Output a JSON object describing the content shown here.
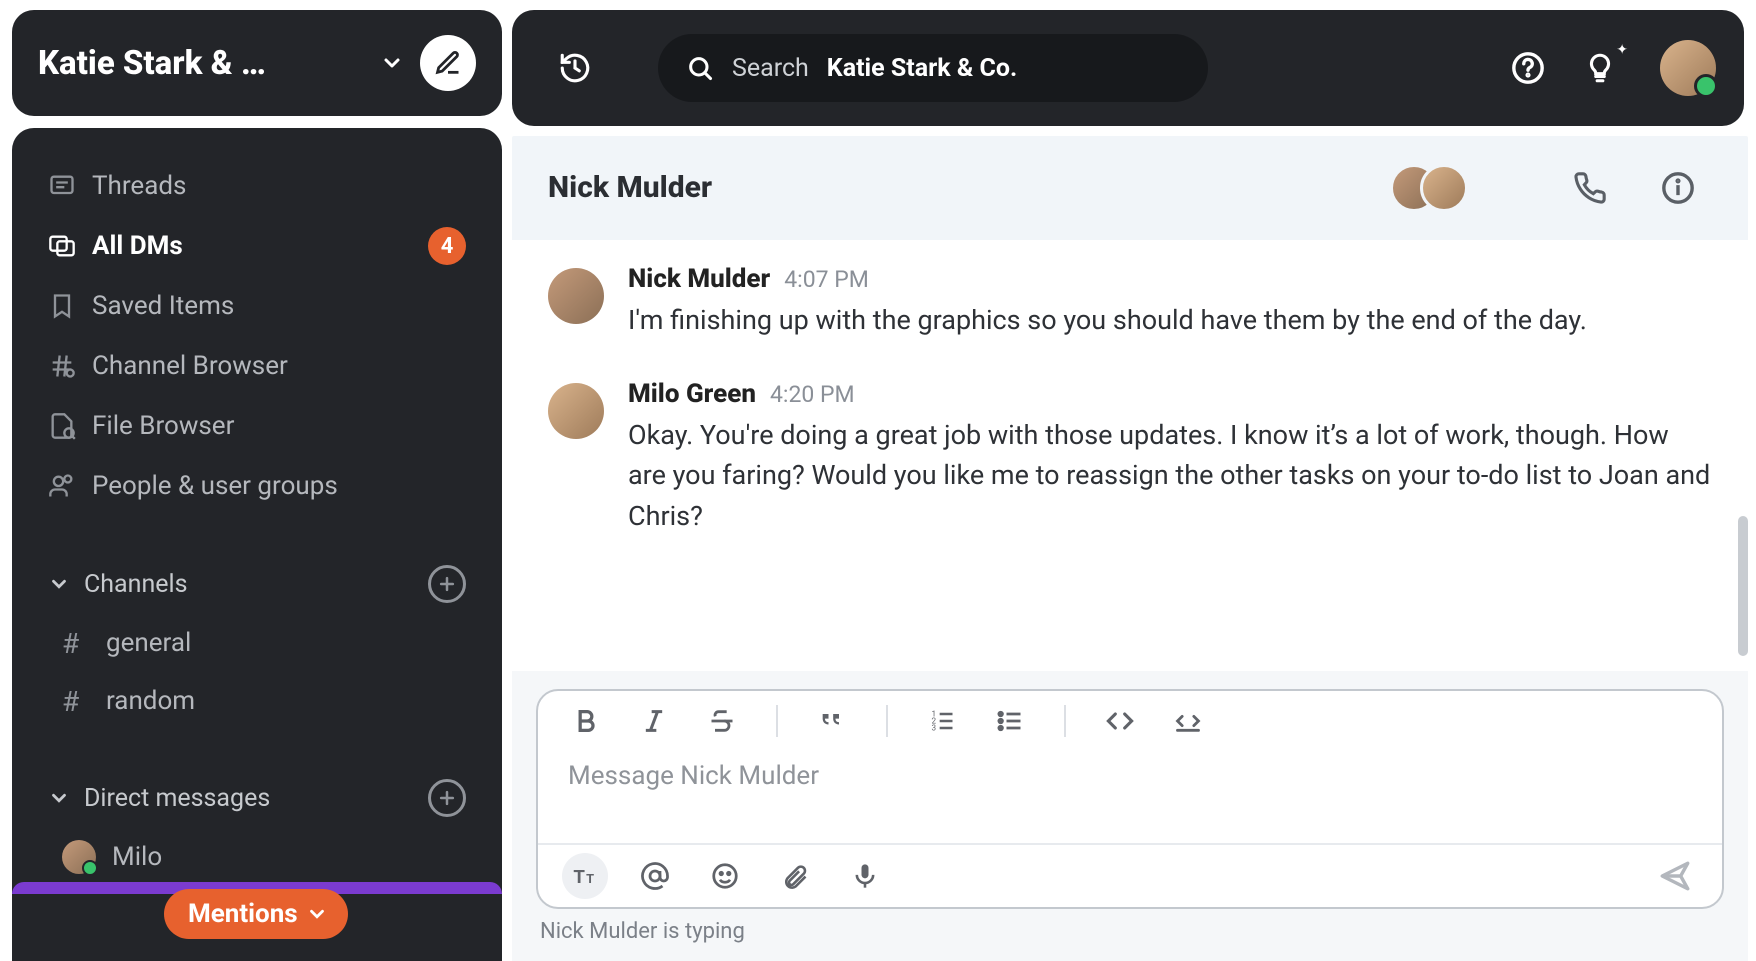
{
  "workspace": {
    "name": "Katie Stark & …"
  },
  "search": {
    "label": "Search",
    "scope": "Katie Stark & Co."
  },
  "sidebar": {
    "threads": "Threads",
    "all_dms": "All DMs",
    "all_dms_badge": "4",
    "saved_items": "Saved Items",
    "channel_browser": "Channel Browser",
    "file_browser": "File Browser",
    "people_groups": "People & user groups",
    "channels_title": "Channels",
    "channels": [
      {
        "name": "general"
      },
      {
        "name": "random"
      }
    ],
    "dms_title": "Direct messages",
    "dms": [
      {
        "name": "Milo"
      }
    ],
    "mentions_label": "Mentions"
  },
  "conversation": {
    "title": "Nick Mulder",
    "messages": [
      {
        "author": "Nick Mulder",
        "time": "4:07 PM",
        "text": "I'm finishing up with the graphics so you should have them by the end of the day."
      },
      {
        "author": "Milo Green",
        "time": "4:20 PM",
        "text": "Okay. You're doing a great job with those updates. I know it’s a lot of work, though. How are you faring? Would you like me to reassign the other tasks on your to-do list to Joan and Chris?"
      }
    ]
  },
  "composer": {
    "placeholder": "Message Nick Mulder",
    "typing": "Nick Mulder is typing"
  }
}
